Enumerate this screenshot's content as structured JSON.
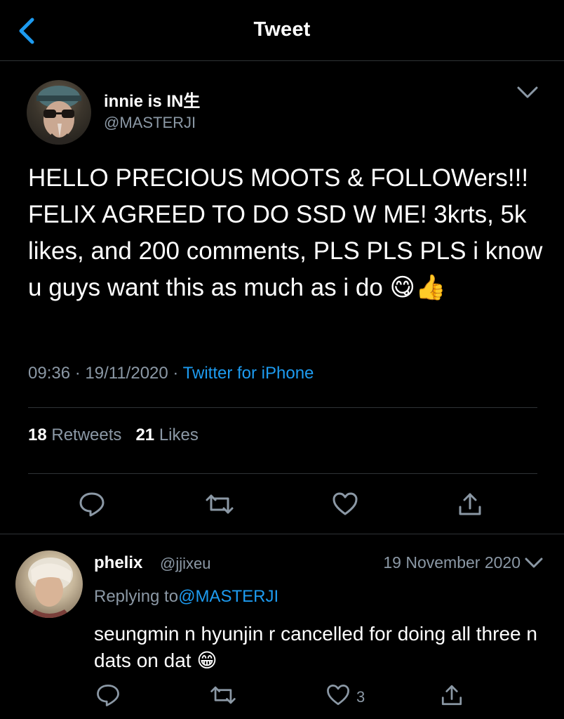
{
  "header": {
    "title": "Tweet",
    "back_icon": "chevron-left-icon"
  },
  "tweet": {
    "author_name": "innie is IN生",
    "author_handle": "@MASTERJI",
    "text": "HELLO PRECIOUS MOOTS & FOLLOWers!!! FELIX AGREED TO DO SSD W ME! 3krts, 5k likes, and 200 comments, PLS PLS PLS i know u guys want this as much as i do 😋👍",
    "time": "09:36",
    "date": "19/11/2020",
    "source": "Twitter for iPhone",
    "retweets_count": "18",
    "retweets_label": "Retweets",
    "likes_count": "21",
    "likes_label": "Likes"
  },
  "reply": {
    "author_name": "phelix",
    "author_handle": "@jjixeu",
    "date": "19 November 2020",
    "replying_prefix": "Replying to",
    "replying_handle": "@MASTERJI",
    "text": "seungmin n hyunjin r cancelled for doing all three n dats on dat 😁",
    "like_count": "3"
  },
  "colors": {
    "background": "#000000",
    "text": "#ffffff",
    "secondary": "#8b98a5",
    "accent": "#1d9bf0",
    "divider": "#2f3336"
  }
}
